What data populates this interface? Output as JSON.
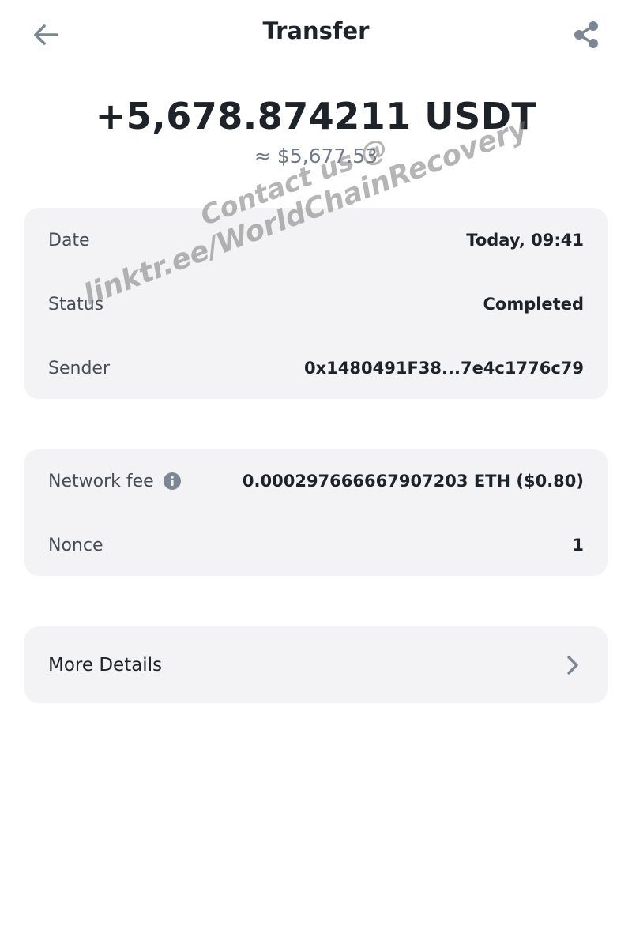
{
  "header": {
    "title": "Transfer",
    "back_icon": "arrow-left-icon",
    "share_icon": "share-icon"
  },
  "amount": {
    "value": "+5,678.874211 USDT",
    "fiat": "≈ $5,677.53"
  },
  "details": {
    "date_label": "Date",
    "date_value": "Today, 09:41",
    "status_label": "Status",
    "status_value": "Completed",
    "sender_label": "Sender",
    "sender_value": "0x1480491F38...7e4c1776c79"
  },
  "fees": {
    "network_fee_label": "Network fee",
    "network_fee_value": "0.000297666667907203 ETH ($0.80)",
    "nonce_label": "Nonce",
    "nonce_value": "1"
  },
  "more": {
    "label": "More Details"
  },
  "watermark": {
    "line1": "Contact us @",
    "line2": "linktr.ee/WorldChainRecovery"
  },
  "colors": {
    "background": "#ffffff",
    "card": "#f3f3f5",
    "text_primary": "#1e2329",
    "text_secondary": "#707a8a",
    "icon": "#7d8694"
  }
}
